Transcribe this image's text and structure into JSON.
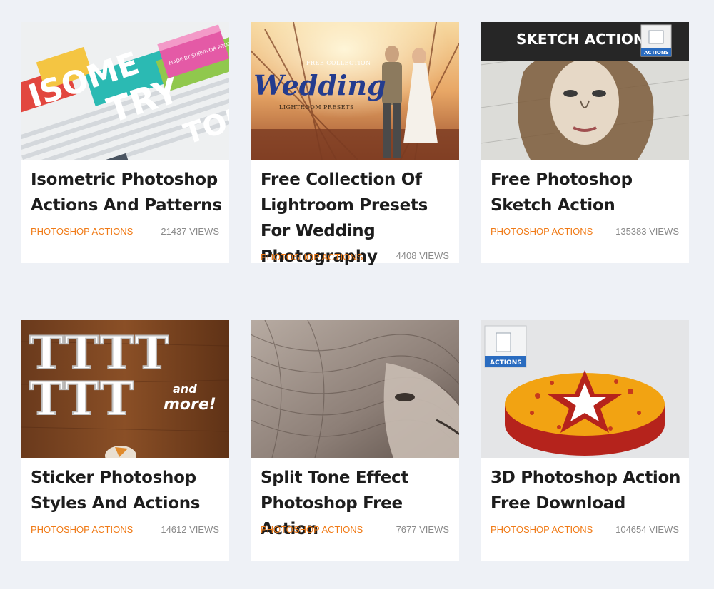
{
  "cards": [
    {
      "title": "Isometric Photoshop Actions And Patterns",
      "category": "PHOTOSHOP ACTIONS",
      "views": "21437 VIEWS",
      "image": {
        "big_text_1": "ISOME",
        "big_text_2": "TRY",
        "big_text_3": "TOR",
        "badge": "MADE BY SURVIVOR PRODUCTIONS"
      }
    },
    {
      "title": "Free Collection Of Lightroom Presets For Wedding Photography",
      "category": "PHOTOSHOP ACTIONS",
      "views": "4408 VIEWS",
      "image": {
        "top": "FREE COLLECTION",
        "script": "Wedding",
        "sub": "LIGHTROOM PRESETS"
      }
    },
    {
      "title": "Free Photoshop Sketch Action",
      "category": "PHOTOSHOP ACTIONS",
      "views": "135383 VIEWS",
      "image": {
        "header": "SKETCH ACTION",
        "badge": "ACTIONS"
      }
    },
    {
      "title": "Sticker Photoshop Styles And Actions",
      "category": "PHOTOSHOP ACTIONS",
      "views": "14612 VIEWS",
      "image": {
        "letters": "TTTT",
        "letters2": "TTT",
        "and": "and",
        "more": "more!"
      }
    },
    {
      "title": "Split Tone Effect Photoshop Free Action",
      "category": "PHOTOSHOP ACTIONS",
      "views": "7677 VIEWS",
      "image": {}
    },
    {
      "title": "3D Photoshop Action Free Download",
      "category": "PHOTOSHOP ACTIONS",
      "views": "104654 VIEWS",
      "image": {
        "badge": "ACTIONS"
      }
    }
  ],
  "colors": {
    "background": "#eef1f6",
    "category": "#f07a16",
    "views": "#8a8a8a",
    "title": "#1d1d1d"
  }
}
